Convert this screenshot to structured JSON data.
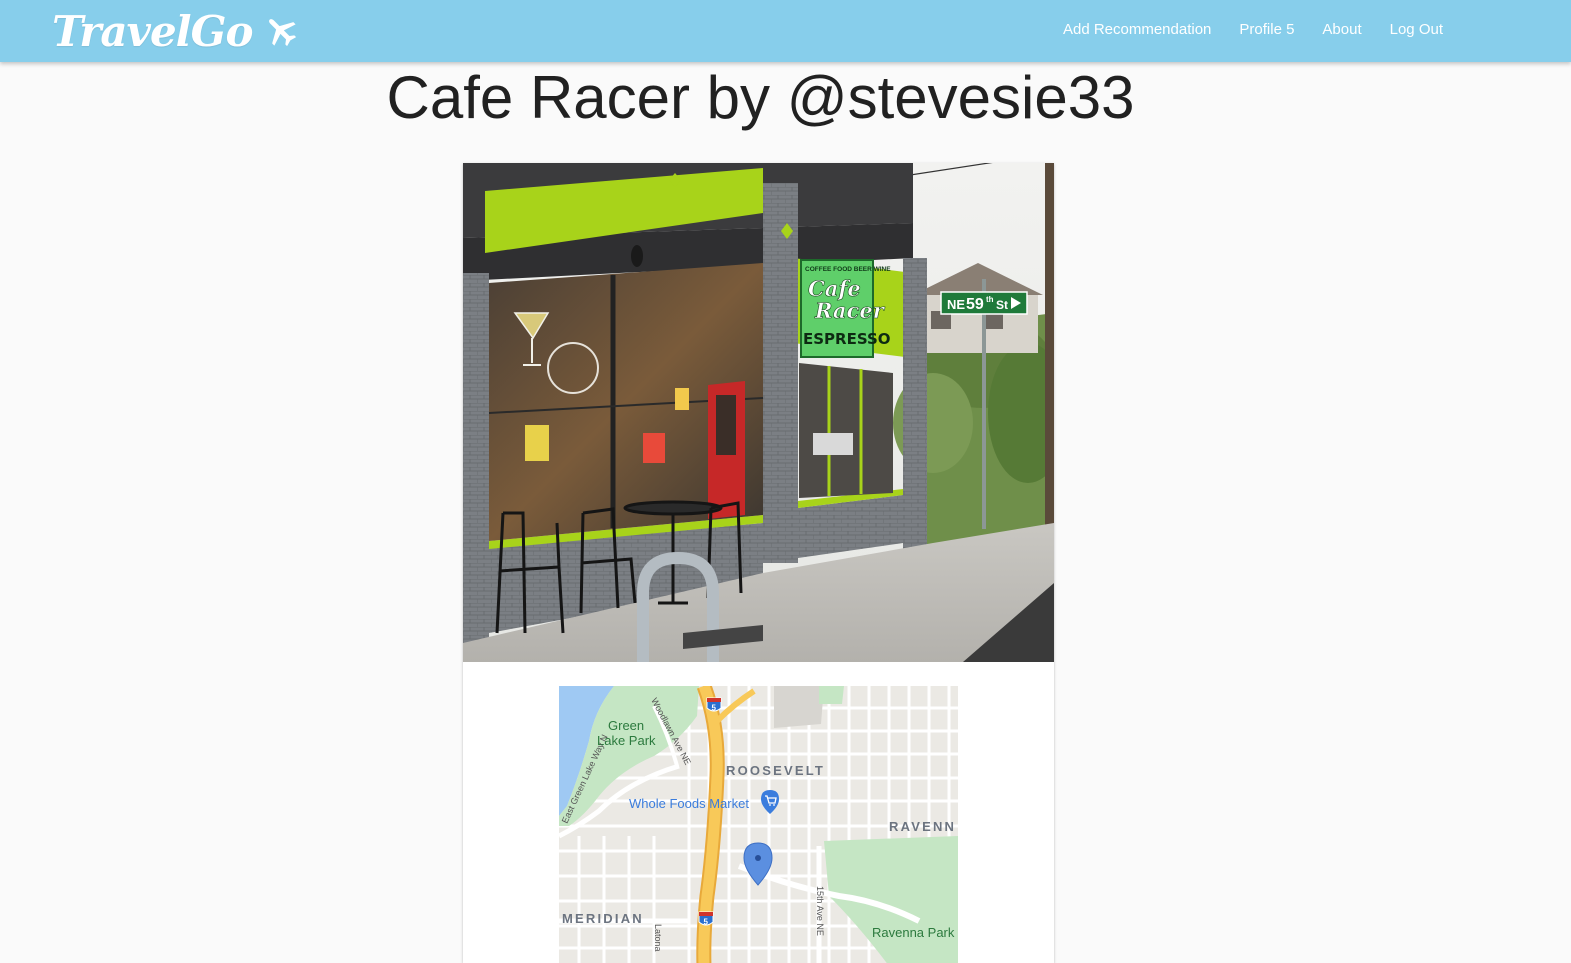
{
  "brand": {
    "name": "TravelGo",
    "icon": "airplane-icon"
  },
  "nav": {
    "items": [
      {
        "label": "Add Recommendation"
      },
      {
        "label": "Profile 5"
      },
      {
        "label": "About"
      },
      {
        "label": "Log Out"
      }
    ]
  },
  "page": {
    "title": "Cafe Racer by @stevesie33"
  },
  "photo": {
    "sign_top": "COFFEE FOOD BEER WINE",
    "sign_name_line1": "Cafe",
    "sign_name_line2": "Racer",
    "sign_espresso": "ESPRESSO",
    "street_sign_prefix": "NE",
    "street_sign_number": "59",
    "street_sign_sup": "th",
    "street_sign_suffix": "St"
  },
  "map": {
    "labels": {
      "green_lake_park_1": "Green",
      "green_lake_park_2": "Lake Park",
      "woodlawn": "Woodlawn Ave NE",
      "east_green_lake": "East Green Lake Way N",
      "roosevelt": "ROOSEVELT",
      "whole_foods": "Whole Foods Market",
      "ravenna": "RAVENN",
      "meridian": "MERIDIAN",
      "fifteenth": "15th Ave NE",
      "ravenna_park": "Ravenna Park",
      "latona": "Latona",
      "interstate_shield": "5"
    },
    "icons": {
      "marker": "map-pin-icon",
      "shopping": "shopping-cart-icon",
      "highway": "interstate-shield-icon"
    },
    "colors": {
      "highway": "#f8c959",
      "park": "#c5e6c4",
      "water": "#9fc9f3",
      "marker": "#5b8fe0",
      "poi": "#3b7ddd"
    }
  }
}
